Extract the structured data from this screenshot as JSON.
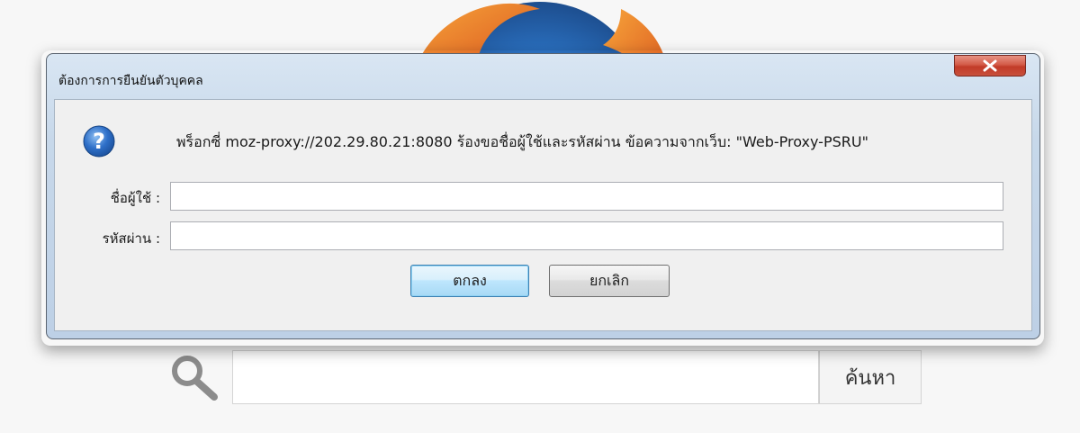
{
  "dialog": {
    "title": "ต้องการการยืนยันตัวบุคคล",
    "message": "พร็อกซี่ moz-proxy://202.29.80.21:8080 ร้องขอชื่อผู้ใช้และรหัสผ่าน ข้อความจากเว็บ: \"Web-Proxy-PSRU\"",
    "username_label": "ชื่อผู้ใช้ :",
    "username_value": "",
    "password_label": "รหัสผ่าน :",
    "password_value": "",
    "ok_label": "ตกลง",
    "cancel_label": "ยกเลิก",
    "close_icon": "close-icon",
    "info_icon": "question-icon"
  },
  "background": {
    "search_button_label": "ค้นหา",
    "search_value": "",
    "search_icon": "search-icon",
    "logo": "browser-logo"
  },
  "colors": {
    "close_red": "#c8503c",
    "ok_border": "#3c7fb1",
    "question_blue": "#2e6fc8"
  }
}
